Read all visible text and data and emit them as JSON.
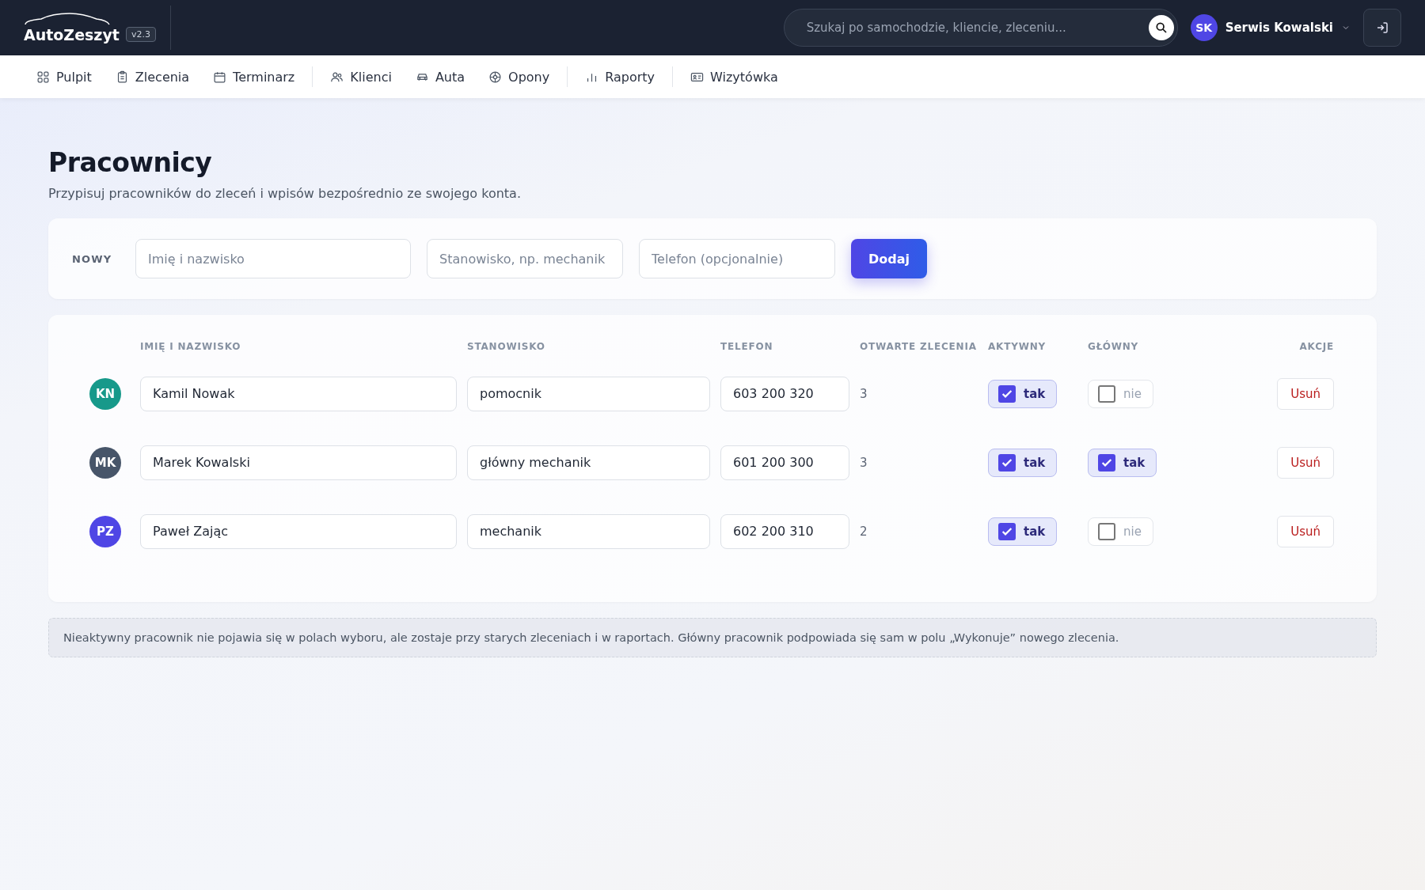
{
  "app": {
    "name": "AutoZeszyt",
    "version": "v2.3"
  },
  "search": {
    "placeholder": "Szukaj po samochodzie, kliencie, zleceniu..."
  },
  "user": {
    "initials": "SK",
    "name": "Serwis Kowalski"
  },
  "nav_groups": [
    [
      {
        "label": "Pulpit"
      },
      {
        "label": "Zlecenia"
      },
      {
        "label": "Terminarz"
      }
    ],
    [
      {
        "label": "Klienci"
      },
      {
        "label": "Auta"
      },
      {
        "label": "Opony"
      }
    ],
    [
      {
        "label": "Raporty"
      }
    ],
    [
      {
        "label": "Wizytówka"
      }
    ]
  ],
  "page": {
    "title": "Pracownicy",
    "subtitle": "Przypisuj pracowników do zleceń i wpisów bezpośrednio ze swojego konta."
  },
  "new_form": {
    "label": "NOWY",
    "fields": [
      {
        "placeholder": "Imię i nazwisko"
      },
      {
        "placeholder": "Stanowisko, np. mechanik"
      },
      {
        "placeholder": "Telefon (opcjonalnie)"
      }
    ],
    "button": "Dodaj"
  },
  "table": {
    "columns": [
      "IMIĘ I NAZWISKO",
      "STANOWISKO",
      "TELEFON",
      "OTWARTE ZLECENIA",
      "AKTYWNY",
      "GŁÓWNY",
      "AKCJE"
    ],
    "rows": [
      {
        "initials": "KN",
        "color": "#17998a",
        "name": "Kamil Nowak",
        "position": "pomocnik",
        "phone": "603 200 320",
        "open_orders": "3",
        "active": {
          "checked": true,
          "label": "tak"
        },
        "main": {
          "checked": false,
          "label": "nie"
        },
        "action": "Usuń"
      },
      {
        "initials": "MK",
        "color": "#475569",
        "name": "Marek Kowalski",
        "position": "główny mechanik",
        "phone": "601 200 300",
        "open_orders": "3",
        "active": {
          "checked": true,
          "label": "tak"
        },
        "main": {
          "checked": true,
          "label": "tak"
        },
        "action": "Usuń"
      },
      {
        "initials": "PZ",
        "color": "#4f46e5",
        "name": "Paweł Zając",
        "position": "mechanik",
        "phone": "602 200 310",
        "open_orders": "2",
        "active": {
          "checked": true,
          "label": "tak"
        },
        "main": {
          "checked": false,
          "label": "nie"
        },
        "action": "Usuń"
      }
    ]
  },
  "note": "Nieaktywny pracownik nie pojawia się w polach wyboru, ale zostaje przy starych zleceniach i w raportach. Główny pracownik podpowiada się sam w polu „Wykonuje” nowego zlecenia."
}
